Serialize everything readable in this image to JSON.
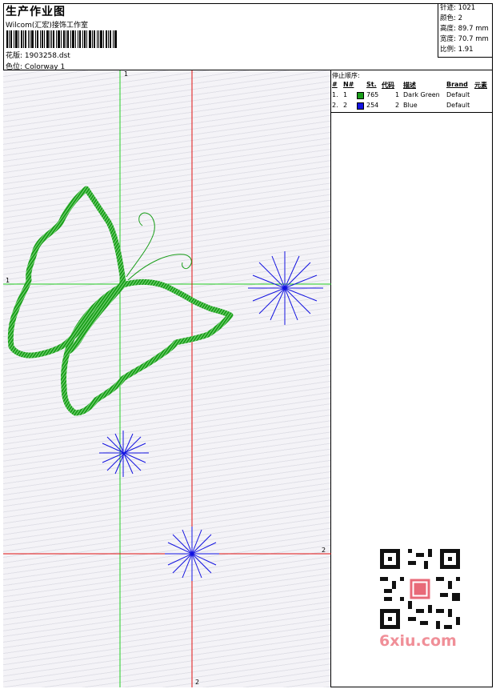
{
  "header": {
    "title": "生产作业图",
    "company": "Wilcom(汇宏)接饰工作室",
    "design_label": "花版:",
    "design_value": "1903258.dst",
    "colorway_label": "色位:",
    "colorway_value": "Colorway 1"
  },
  "stats": [
    {
      "label": "针迹:",
      "value": "1021"
    },
    {
      "label": "颜色:",
      "value": "2"
    },
    {
      "label": "高度:",
      "value": "89.7 mm"
    },
    {
      "label": "宽度:",
      "value": "70.7 mm"
    },
    {
      "label": "比例:",
      "value": "1.91"
    }
  ],
  "stop_sequence": {
    "title": "停止顺序:",
    "columns": [
      "#",
      "N#",
      "St.",
      "代码",
      "描述",
      "Brand",
      "元素"
    ],
    "rows": [
      {
        "index": "1.",
        "n": "1",
        "color": "#1a9e1a",
        "stitches": "765",
        "code": "1",
        "description": "Dark Green",
        "brand": "Default"
      },
      {
        "index": "2.",
        "n": "2",
        "color": "#1313e0",
        "stitches": "254",
        "code": "2",
        "description": "Blue",
        "brand": "Default"
      }
    ]
  },
  "guides": {
    "green_vertical": "1",
    "green_horizontal": "1",
    "red_vertical": "2",
    "red_horizontal": "2"
  },
  "colors": {
    "green_thread": "#1a9e1a",
    "blue_thread": "#1313e0",
    "green_guide": "#22cc22",
    "red_guide": "#e01010",
    "watermark": "#f08f98"
  },
  "watermark": "6xiu.com"
}
